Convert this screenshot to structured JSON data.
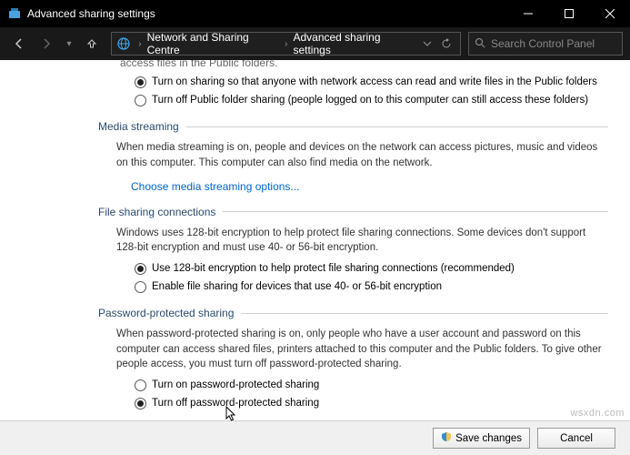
{
  "window": {
    "title": "Advanced sharing settings"
  },
  "nav": {
    "crumb1": "Network and Sharing Centre",
    "crumb2": "Advanced sharing settings",
    "search_placeholder": "Search Control Panel"
  },
  "truncated_top": "access files in the Public folders.",
  "public_folder": {
    "opt_on": "Turn on sharing so that anyone with network access can read and write files in the Public folders",
    "opt_off": "Turn off Public folder sharing (people logged on to this computer can still access these folders)"
  },
  "media": {
    "header": "Media streaming",
    "body": "When media streaming is on, people and devices on the network can access pictures, music and videos on this computer. This computer can also find media on the network.",
    "link": "Choose media streaming options..."
  },
  "file_conn": {
    "header": "File sharing connections",
    "body": "Windows uses 128-bit encryption to help protect file sharing connections. Some devices don't support 128-bit encryption and must use 40- or 56-bit encryption.",
    "opt_128": "Use 128-bit encryption to help protect file sharing connections (recommended)",
    "opt_4056": "Enable file sharing for devices that use 40- or 56-bit encryption"
  },
  "password": {
    "header": "Password-protected sharing",
    "body": "When password-protected sharing is on, only people who have a user account and password on this computer can access shared files, printers attached to this computer and the Public folders. To give other people access, you must turn off password-protected sharing.",
    "opt_on": "Turn on password-protected sharing",
    "opt_off": "Turn off password-protected sharing"
  },
  "footer": {
    "save": "Save changes",
    "cancel": "Cancel"
  },
  "watermark": "wsxdn.com"
}
